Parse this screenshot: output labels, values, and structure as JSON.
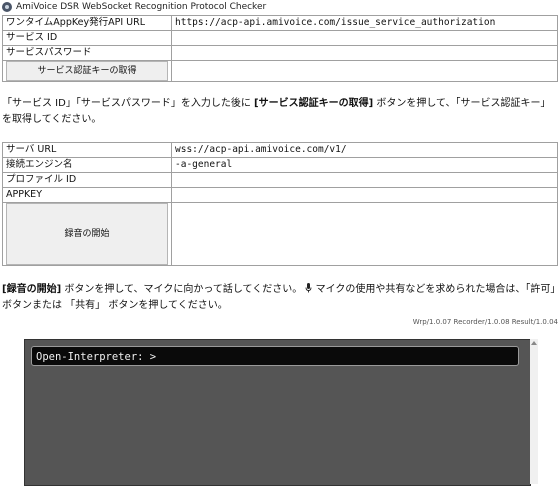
{
  "window": {
    "title": "AmiVoice DSR WebSocket Recognition Protocol Checker",
    "icon": "app-icon"
  },
  "auth_form": {
    "apikey_url_label": "ワンタイムAppKey発行API URL",
    "apikey_url_value": "https://acp-api.amivoice.com/issue_service_authorization",
    "service_id_label": "サービス ID",
    "service_id_value": "",
    "service_password_label": "サービスパスワード",
    "service_password_value": "",
    "get_key_button": "サービス認証キーの取得",
    "auth_key_value": ""
  },
  "auth_note": {
    "part1": "「サービス ID」「サービスパスワード」を入力した後に ",
    "bold": "[サービス認証キーの取得]",
    "part2": " ボタンを押して、「サービス認証キー」を取得してください。"
  },
  "recog_form": {
    "server_url_label": "サーバ URL",
    "server_url_value": "wss://acp-api.amivoice.com/v1/",
    "engine_label": "接続エンジン名",
    "engine_value": "-a-general",
    "profile_label": "プロファイル ID",
    "profile_value": "",
    "appkey_label": "APPKEY",
    "appkey_value": "",
    "record_button": "録音の開始",
    "result_value": ""
  },
  "record_note": {
    "bold": "[録音の開始]",
    "part1": " ボタンを押して、マイクに向かって話してください。",
    "mic_icon": "microphone-icon",
    "part2": " マイクの使用や共有などを求められた場合は、「許可」ボタンまたは 「共有」 ボタンを押してください。"
  },
  "versions": "Wrp/1.0.07 Recorder/1.0.08 Result/1.0.04",
  "console": {
    "prompt": "Open-Interpreter: >",
    "background": "#555555"
  }
}
